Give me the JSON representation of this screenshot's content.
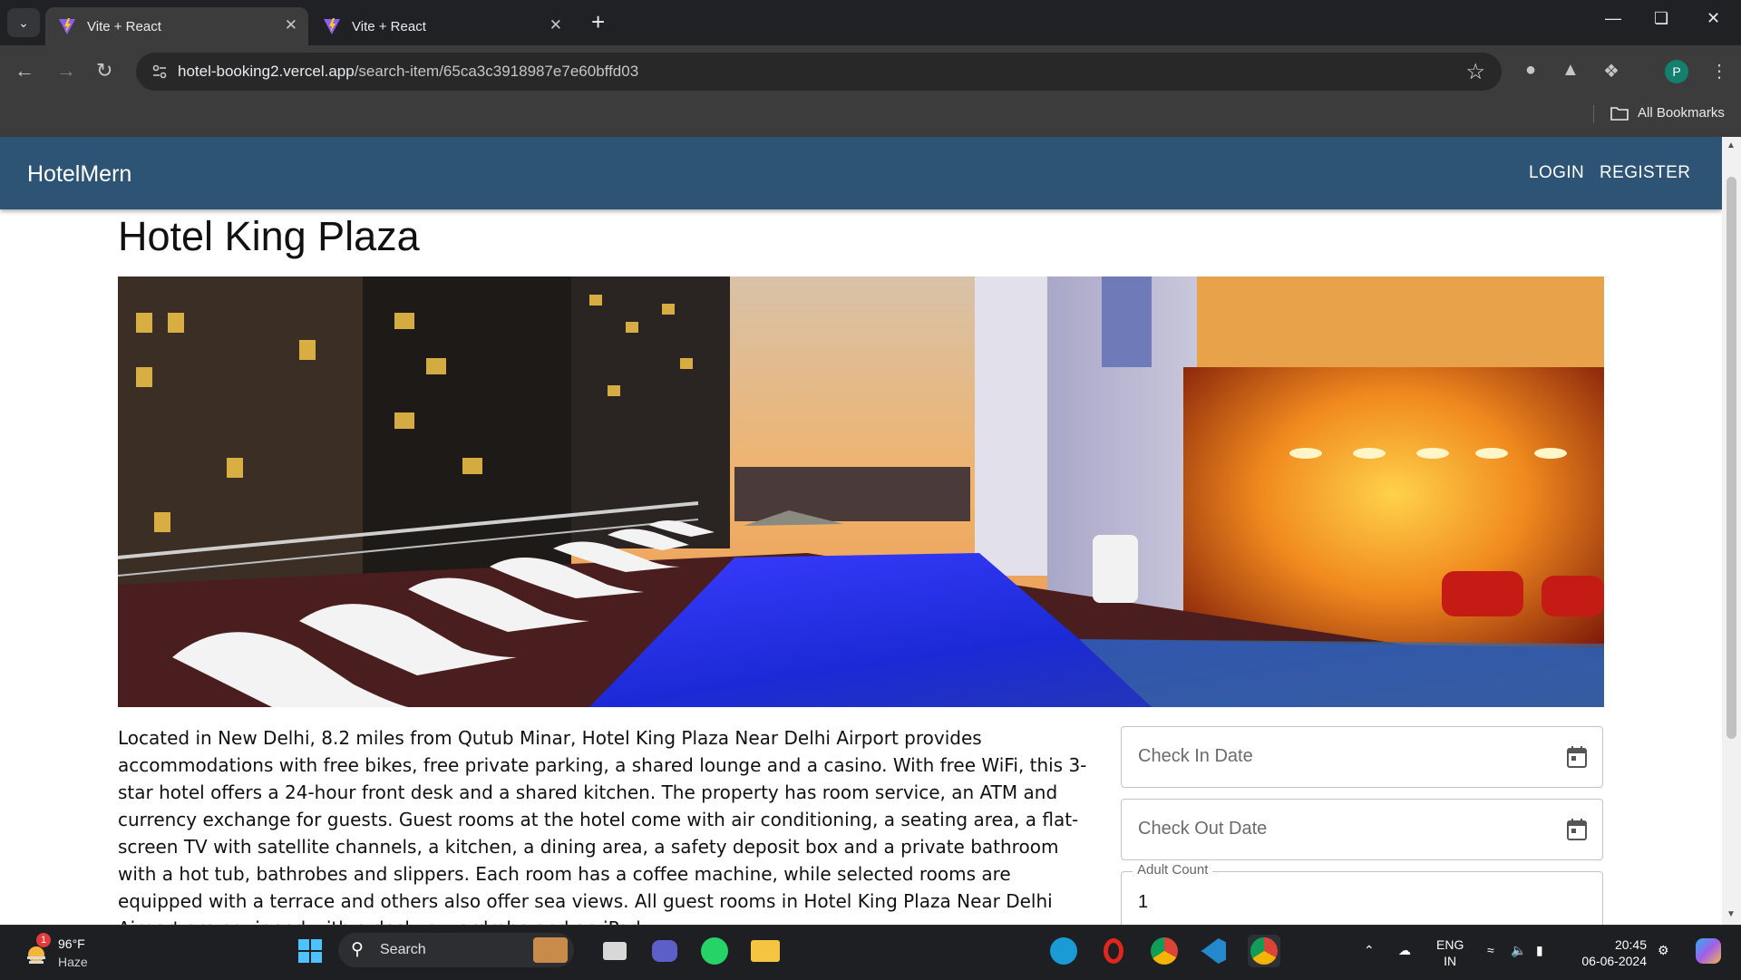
{
  "browser": {
    "tabs": [
      {
        "title": "Vite + React",
        "active": true
      },
      {
        "title": "Vite + React",
        "active": false
      }
    ],
    "url_host": "hotel-booking2.vercel.app",
    "url_path": "/search-item/65ca3c3918987e7e60bffd03",
    "bookmarks_label": "All Bookmarks",
    "profile_initial": "P"
  },
  "app": {
    "brand": "HotelMern",
    "nav": {
      "login": "LOGIN",
      "register": "REGISTER"
    },
    "colors": {
      "appbar": "#2d5474"
    }
  },
  "hotel": {
    "name": "Hotel King Plaza",
    "description": "Located in New Delhi, 8.2 miles from Qutub Minar, Hotel King Plaza Near Delhi Airport provides accommodations with free bikes, free private parking, a shared lounge and a casino. With free WiFi, this 3-star hotel offers a 24-hour front desk and a shared kitchen. The property has room service, an ATM and currency exchange for guests. Guest rooms at the hotel come with air conditioning, a seating area, a flat-screen TV with satellite channels, a kitchen, a dining area, a safety deposit box and a private bathroom with a hot tub, bathrobes and slippers. Each room has a coffee machine, while selected rooms are equipped with a terrace and others also offer sea views. All guest rooms in Hotel King Plaza Near Delhi Airport are equipped with a desk, a wardrobe and an iPad."
  },
  "booking": {
    "check_in_placeholder": "Check In Date",
    "check_out_placeholder": "Check Out Date",
    "adult_count_label": "Adult Count",
    "adult_count_value": "1"
  },
  "taskbar": {
    "weather_temp": "96°F",
    "weather_desc": "Haze",
    "weather_badge": "1",
    "search_label": "Search",
    "lang_line1": "ENG",
    "lang_line2": "IN",
    "time": "20:45",
    "date": "06-06-2024"
  }
}
